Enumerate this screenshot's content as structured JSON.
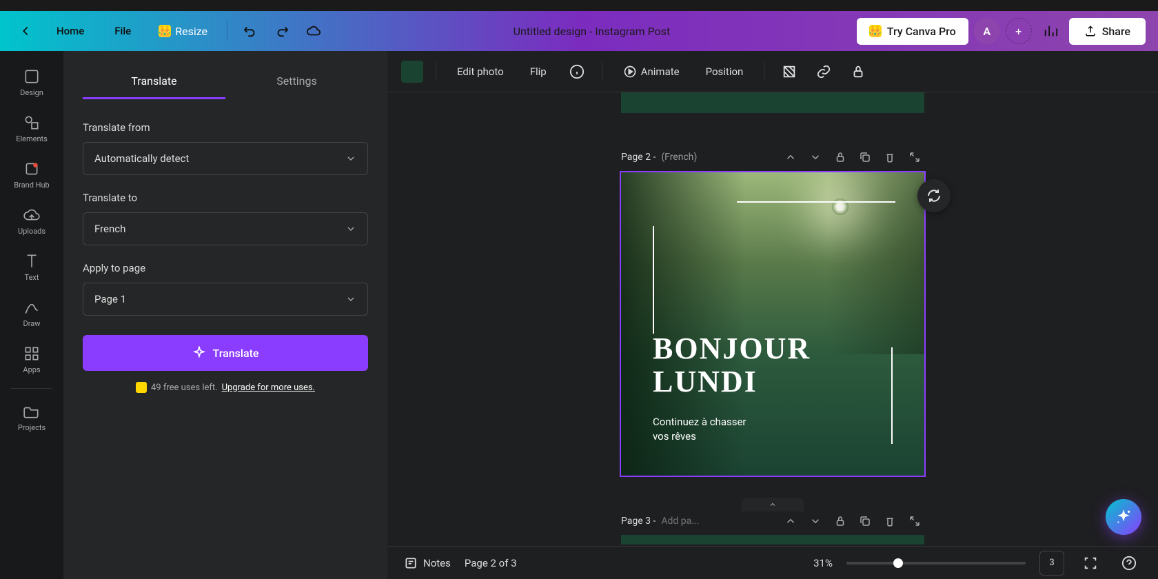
{
  "header": {
    "home": "Home",
    "file": "File",
    "resize": "Resize",
    "title": "Untitled design - Instagram Post",
    "try_pro": "Try Canva Pro",
    "avatar_initial": "A",
    "share": "Share"
  },
  "rail": {
    "design": "Design",
    "elements": "Elements",
    "brand_hub": "Brand Hub",
    "uploads": "Uploads",
    "text": "Text",
    "draw": "Draw",
    "apps": "Apps",
    "projects": "Projects"
  },
  "panel": {
    "tab_translate": "Translate",
    "tab_settings": "Settings",
    "from_label": "Translate from",
    "from_value": "Automatically detect",
    "to_label": "Translate to",
    "to_value": "French",
    "apply_label": "Apply to page",
    "apply_value": "Page 1",
    "translate_btn": "Translate",
    "uses_left": "49 free uses left.",
    "upgrade_link": "Upgrade for more uses."
  },
  "context": {
    "edit_photo": "Edit photo",
    "flip": "Flip",
    "animate": "Animate",
    "position": "Position"
  },
  "pages": {
    "page2_label": "Page 2 -",
    "page2_name": "(French)",
    "page3_label": "Page 3 -",
    "page3_placeholder": "Add pa..."
  },
  "design": {
    "heading_line1": "BONJOUR",
    "heading_line2": "LUNDI",
    "sub_line1": "Continuez à chasser",
    "sub_line2": "vos rêves"
  },
  "footer": {
    "notes": "Notes",
    "page_of": "Page 2 of 3",
    "zoom": "31%",
    "grid_count": "3"
  }
}
